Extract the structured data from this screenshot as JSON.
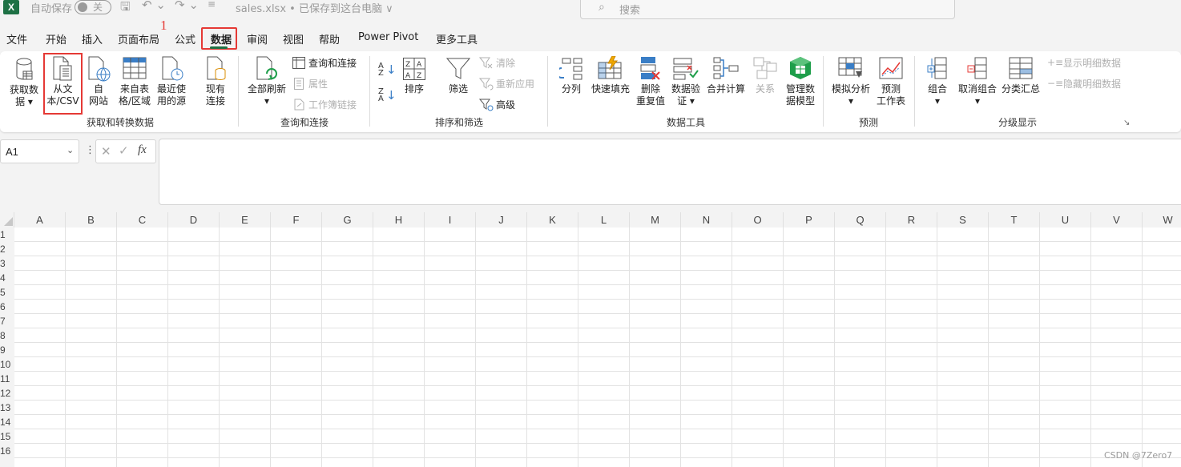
{
  "titlebar": {
    "logo": "X",
    "autosave_label": "自动保存",
    "autosave_state": "关",
    "file_title": "sales.xlsx • 已保存到这台电脑 ∨",
    "search_placeholder": "搜索"
  },
  "tabs": [
    "文件",
    "开始",
    "插入",
    "页面布局",
    "公式",
    "数据",
    "审阅",
    "视图",
    "帮助",
    "Power Pivot",
    "更多工具"
  ],
  "active_tab": "数据",
  "annotation_marker": "1",
  "ribbon": {
    "get_transform": {
      "group_label": "获取和转换数据",
      "get_data": [
        "获取数",
        "据 ▾"
      ],
      "from_text_csv": [
        "从文",
        "本/CSV"
      ],
      "from_web": [
        "自",
        "网站"
      ],
      "from_table": [
        "来自表",
        "格/区域"
      ],
      "recent_sources": [
        "最近使",
        "用的源"
      ],
      "existing_conn": [
        "现有",
        "连接"
      ]
    },
    "queries": {
      "group_label": "查询和连接",
      "refresh_all": [
        "全部刷新",
        "▾"
      ],
      "queries_connections": "查询和连接",
      "properties": "属性",
      "workbook_links": "工作簿链接"
    },
    "sort_filter": {
      "group_label": "排序和筛选",
      "sort": "排序",
      "filter": "筛选",
      "clear": "清除",
      "reapply": "重新应用",
      "advanced": "高级"
    },
    "data_tools": {
      "group_label": "数据工具",
      "text_to_columns": "分列",
      "flash_fill": "快速填充",
      "remove_dupes": [
        "删除",
        "重复值"
      ],
      "validation": [
        "数据验",
        "证 ▾"
      ],
      "consolidate": "合并计算",
      "relationships": "关系",
      "data_model": [
        "管理数",
        "据模型"
      ]
    },
    "forecast": {
      "group_label": "预测",
      "what_if": [
        "模拟分析",
        "▾"
      ],
      "forecast_sheet": [
        "预测",
        "工作表"
      ]
    },
    "outline": {
      "group_label": "分级显示",
      "group": [
        "组合",
        "▾"
      ],
      "ungroup": [
        "取消组合",
        "▾"
      ],
      "subtotal": "分类汇总",
      "show_detail": "显示明细数据",
      "hide_detail": "隐藏明细数据"
    }
  },
  "formula_bar": {
    "name_box": "A1",
    "fx": "fx",
    "formula": ""
  },
  "columns": [
    "A",
    "B",
    "C",
    "D",
    "E",
    "F",
    "G",
    "H",
    "I",
    "J",
    "K",
    "L",
    "M",
    "N",
    "O",
    "P",
    "Q",
    "R",
    "S",
    "T",
    "U",
    "V",
    "W"
  ],
  "rows": [
    "1",
    "2",
    "3",
    "4",
    "5",
    "6",
    "7",
    "8",
    "9",
    "10",
    "11",
    "12",
    "13",
    "14",
    "15",
    "16"
  ],
  "watermark": "CSDN @7Zero7"
}
